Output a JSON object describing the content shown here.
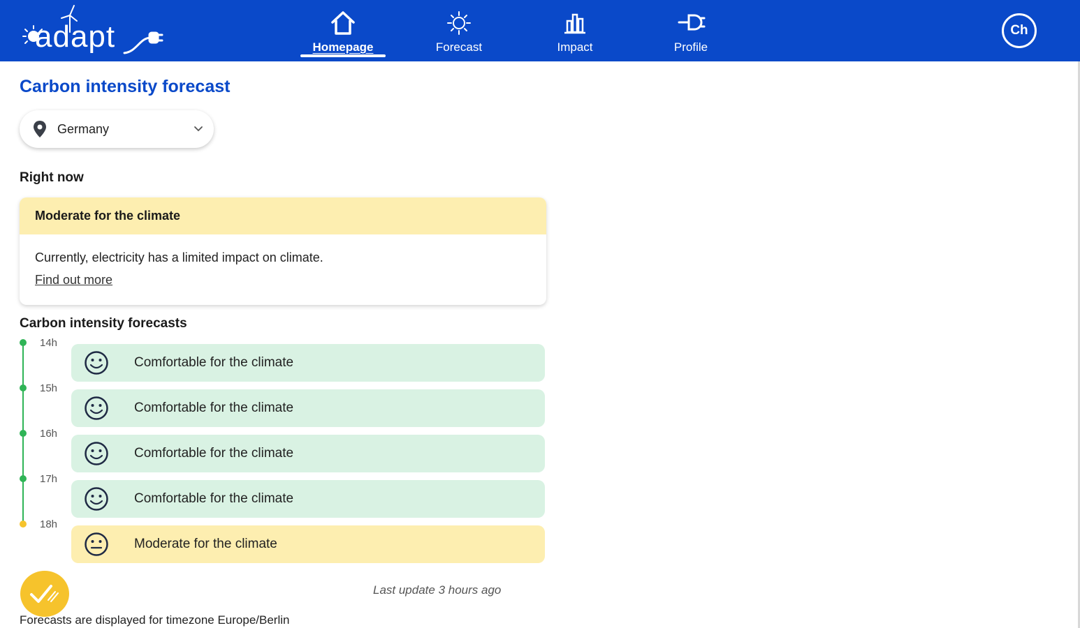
{
  "header": {
    "logo_text": "adapt",
    "nav": [
      {
        "label": "Homepage",
        "icon": "home-icon",
        "active": true
      },
      {
        "label": "Forecast",
        "icon": "sun-icon",
        "active": false
      },
      {
        "label": "Impact",
        "icon": "bar-chart-icon",
        "active": false
      },
      {
        "label": "Profile",
        "icon": "plug-icon",
        "active": false
      }
    ],
    "avatar_initials": "Ch"
  },
  "page": {
    "title": "Carbon intensity forecast",
    "country": "Germany",
    "right_now_label": "Right now",
    "now_card": {
      "status": "Moderate for the climate",
      "description": "Currently, electricity has a limited impact on climate.",
      "link": "Find out more"
    },
    "forecasts_label": "Carbon intensity forecasts",
    "forecasts": [
      {
        "hour": "14h",
        "label": "Comfortable for the climate",
        "level": "comfortable"
      },
      {
        "hour": "15h",
        "label": "Comfortable for the climate",
        "level": "comfortable"
      },
      {
        "hour": "16h",
        "label": "Comfortable for the climate",
        "level": "comfortable"
      },
      {
        "hour": "17h",
        "label": "Comfortable for the climate",
        "level": "comfortable"
      },
      {
        "hour": "18h",
        "label": "Moderate for the climate",
        "level": "moderate"
      }
    ],
    "last_update": "Last update 3 hours ago",
    "timezone_note": "Forecasts are displayed for timezone Europe/Berlin"
  },
  "colors": {
    "brand_blue": "#0a49c9",
    "comfortable_bg": "#d9f2e3",
    "moderate_bg": "#fdeeb0",
    "comfortable_dot": "#2fb456",
    "moderate_dot": "#f6c32c",
    "fab": "#f6c32c"
  }
}
